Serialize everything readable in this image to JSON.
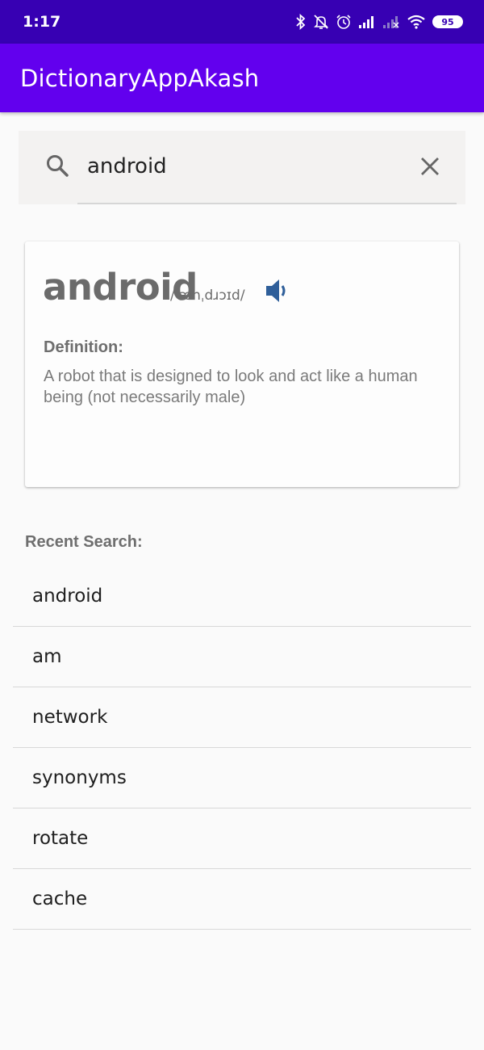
{
  "status_bar": {
    "time": "1:17",
    "battery": "95",
    "icons": [
      "bluetooth-icon",
      "bell-off-icon",
      "alarm-icon",
      "signal-icon",
      "signal-no-sim-icon",
      "wifi-icon",
      "battery-icon"
    ]
  },
  "app_bar": {
    "title": "DictionaryAppAkash",
    "color": "#6200ee",
    "status_color": "#3700b3"
  },
  "search": {
    "value": "android",
    "icon": "search-icon",
    "clear_icon": "close-icon"
  },
  "result": {
    "word": "android",
    "phonetic": "/ˈænˌdɹɔɪd/",
    "speaker_icon": "speaker-icon",
    "definition_label": "Definition:",
    "definition": "A robot that is designed to look and act like a human being (not necessarily male)"
  },
  "recent": {
    "label": "Recent Search:",
    "items": [
      "android",
      "am",
      "network",
      "synonyms",
      "rotate",
      "cache"
    ]
  }
}
